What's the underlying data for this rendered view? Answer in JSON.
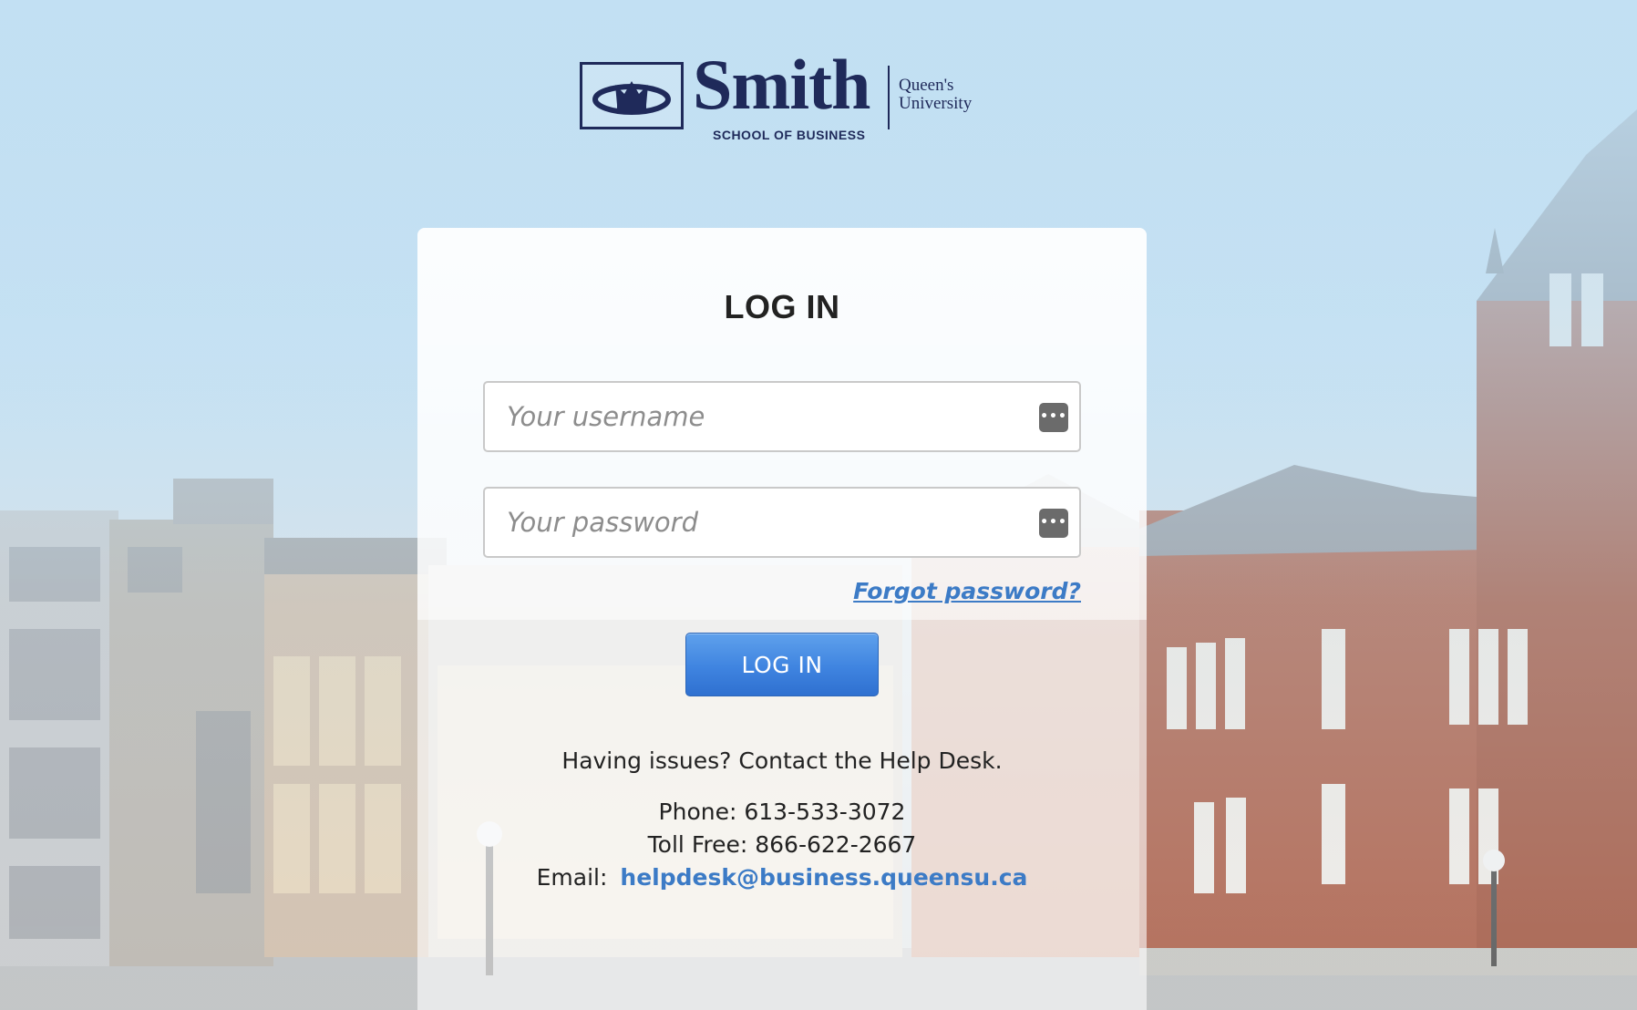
{
  "logo": {
    "wordmark": "Smith",
    "subtitle": "SCHOOL OF BUSINESS",
    "university_line1": "Queen's",
    "university_line2": "University"
  },
  "login": {
    "title": "LOG IN",
    "username_placeholder": "Your username",
    "password_placeholder": "Your password",
    "key_icon": "password-manager-icon",
    "forgot_label": "Forgot password?",
    "button_label": "LOG IN"
  },
  "help": {
    "issue_text": "Having issues? Contact the Help Desk.",
    "phone_text": "Phone: 613-533-3072",
    "tollfree_text": "Toll Free: 866-622-2667",
    "email_label": "Email:",
    "email_address": "helpdesk@business.queensu.ca"
  },
  "colors": {
    "brand_navy": "#1f2a5a",
    "link_blue": "#3c7bc6",
    "button_blue": "#3f84e0"
  }
}
